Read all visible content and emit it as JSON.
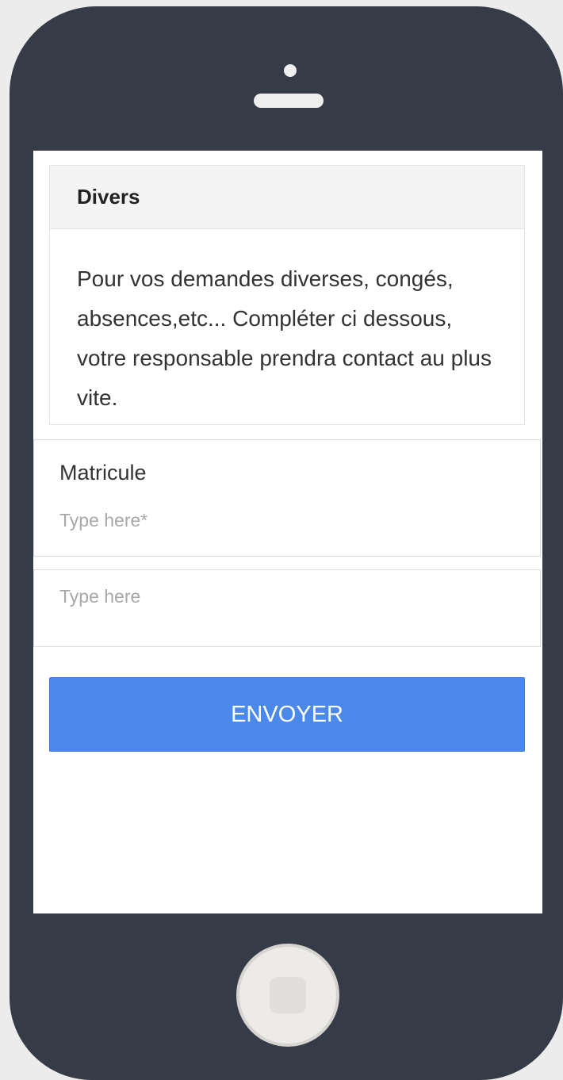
{
  "card": {
    "title": "Divers",
    "description": "Pour vos demandes diverses, congés, absences,etc... Compléter ci dessous, votre responsable prendra contact au plus vite."
  },
  "form": {
    "matricule": {
      "label": "Matricule",
      "value": "",
      "placeholder": "Type here*"
    },
    "message": {
      "value": "",
      "placeholder": "Type here"
    },
    "submit_label": "ENVOYER"
  },
  "colors": {
    "phone_frame": "#363c47",
    "screen": "#ffffff",
    "button": "#4a89ea"
  },
  "icons": {
    "camera": "camera-dot-icon",
    "speaker": "speaker-slot-icon",
    "home": "home-button-icon"
  }
}
